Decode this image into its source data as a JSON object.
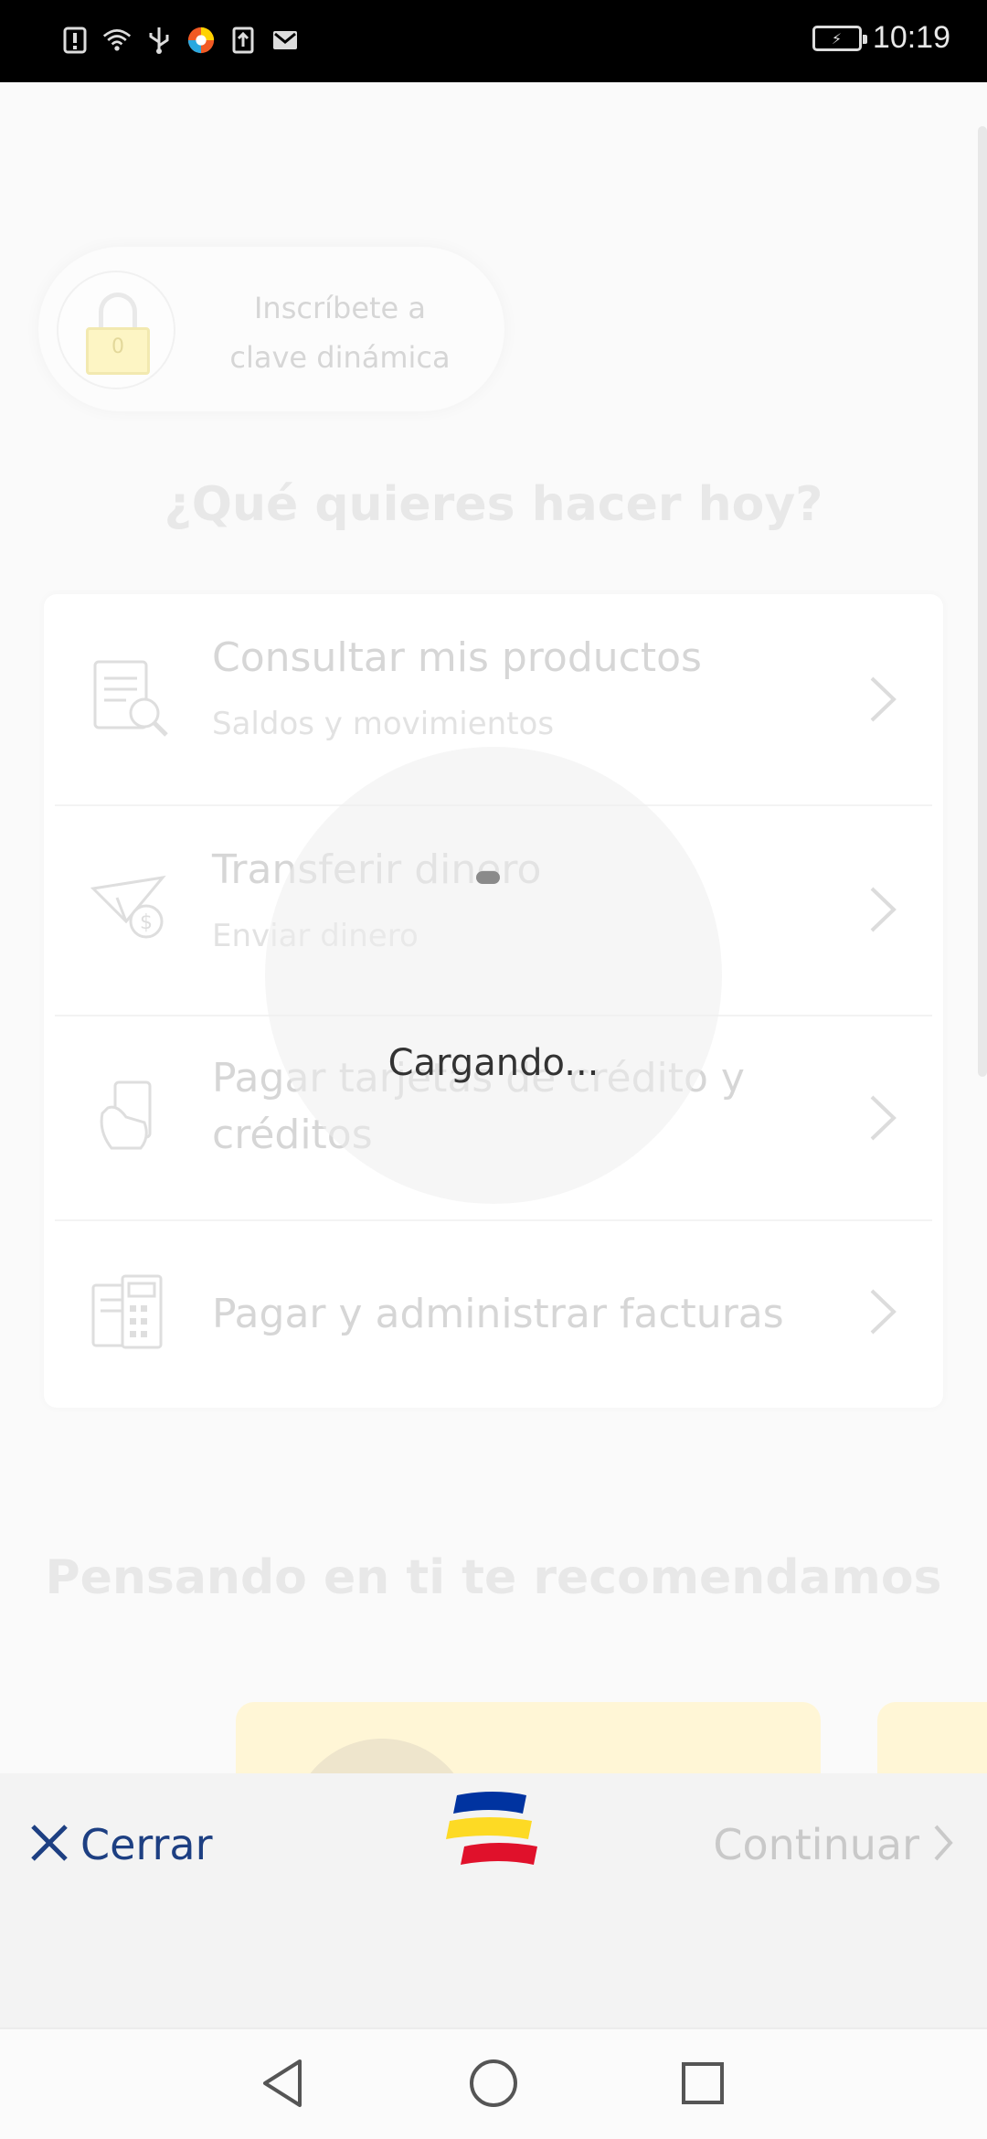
{
  "status_bar": {
    "time": "10:19",
    "left_icons": [
      "alert-icon",
      "wifi-icon",
      "usb-icon",
      "app-icon",
      "upload-icon",
      "mail-icon"
    ]
  },
  "enroll": {
    "line1": "Inscríbete a",
    "line2": "clave dinámica",
    "lock_digit": "0"
  },
  "main": {
    "question_title": "¿Qué quieres hacer hoy?",
    "menu_items": [
      {
        "title": "Consultar mis productos",
        "subtitle": "Saldos y movimientos",
        "icon": "document-search-icon"
      },
      {
        "title": "Transferir dinero",
        "subtitle": "Enviar dinero",
        "icon": "paper-plane-money-icon"
      },
      {
        "title_line1": "Pagar tarjetas de crédito y",
        "title_line2": "créditos",
        "icon": "hand-card-icon"
      },
      {
        "title": "Pagar y administrar facturas",
        "icon": "invoice-calculator-icon"
      }
    ],
    "recommend_title": "Pensando en ti te recomendamos"
  },
  "loading": {
    "text": "Cargando..."
  },
  "action_bar": {
    "close_label": "Cerrar",
    "continue_label": "Continuar"
  },
  "colors": {
    "brand_blue": "#0033a0",
    "brand_yellow": "#fdda24",
    "brand_red": "#e0112b",
    "close_blue": "#1d3f82"
  }
}
